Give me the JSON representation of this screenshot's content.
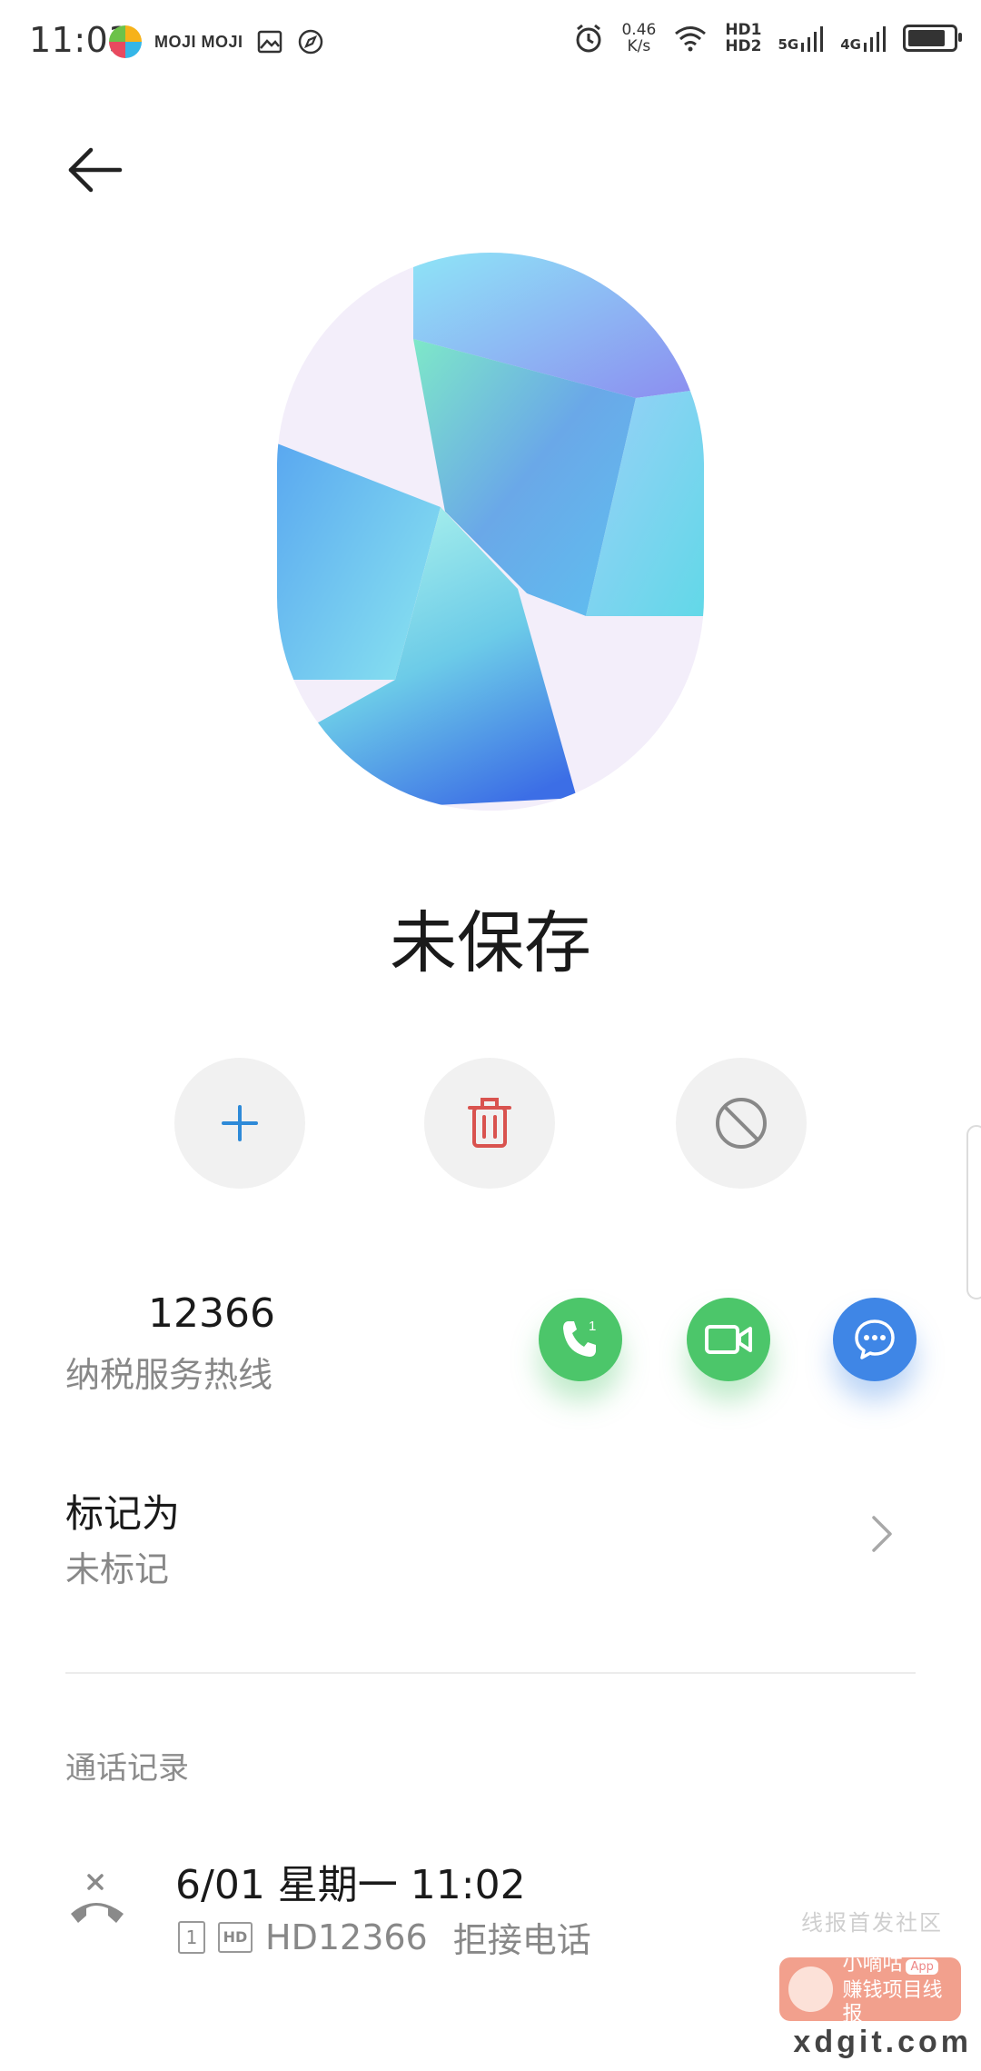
{
  "status_bar": {
    "time": "11:03",
    "moji_label": "MOJI MOJI",
    "net_speed_value": "0.46",
    "net_speed_unit": "K/s",
    "hd1": "HD1",
    "hd2": "HD2",
    "net1": "5G",
    "net2": "4G"
  },
  "contact": {
    "name": "未保存",
    "number": "12366",
    "number_label": "纳税服务热线"
  },
  "call_action": {
    "sim_number": "1"
  },
  "mark": {
    "title": "标记为",
    "value": "未标记"
  },
  "call_log": {
    "section_title": "通话记录",
    "entries": [
      {
        "time": "6/01 星期一 11:02",
        "sim": "1",
        "hd": "HD",
        "number": "HD12366",
        "status": "拒接电话"
      }
    ]
  },
  "watermark": {
    "text": "线报首发社区",
    "brand": "小嘀咕",
    "app": "App",
    "slogan": "赚钱项目线报",
    "url": "xdgit.com"
  },
  "colors": {
    "accent_blue": "#2e8ad8",
    "delete_red": "#d9534f",
    "call_green": "#4cc66a",
    "message_blue": "#3f86e6"
  }
}
